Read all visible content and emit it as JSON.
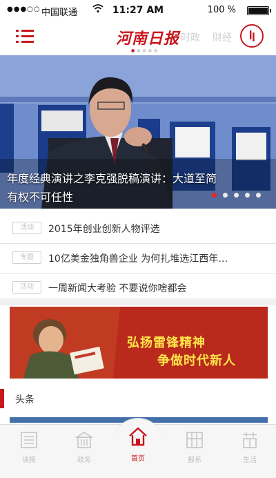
{
  "status_bar": {
    "signal": "●●●○○",
    "carrier": "中国联通",
    "wifi_icon": "wifi-icon",
    "time": "11:27 AM",
    "battery": "100 %",
    "battery_level": 1.0
  },
  "header": {
    "logo": "河南日报",
    "ghost_tabs": [
      "时政",
      "财经"
    ],
    "menu_icon": "menu-icon",
    "user_icon": "user-icon"
  },
  "hero": {
    "caption": "年度经典演讲之李克强脱稿演讲：大道至简 有权不可任性",
    "slide_count": 5,
    "active_slide": 0
  },
  "news": [
    {
      "tag": "活动",
      "title": "2015年创业创新人物评选"
    },
    {
      "tag": "专题",
      "title": "10亿美金独角兽企业 为何扎堆选江西年…"
    },
    {
      "tag": "活动",
      "title": "一周新闻大考验 不要说你啥都会"
    }
  ],
  "banner": {
    "line1": "弘扬雷锋精神",
    "line2": "争做时代新人"
  },
  "section": {
    "label": "头条"
  },
  "tabs": [
    {
      "label": "读报",
      "icon": "newspaper-icon",
      "active": false
    },
    {
      "label": "政务",
      "icon": "government-icon",
      "active": false
    },
    {
      "label": "首页",
      "icon": "home-icon",
      "active": true
    },
    {
      "label": "报系",
      "icon": "grid-icon",
      "active": false
    },
    {
      "label": "生活",
      "icon": "life-icon",
      "active": false
    }
  ],
  "colors": {
    "brand_red": "#c8161d",
    "hero_blue": "#6a86c8",
    "banner_red": "#bf2b1e",
    "banner_text": "#ffe54a",
    "strip_blue": "#456fa8"
  }
}
